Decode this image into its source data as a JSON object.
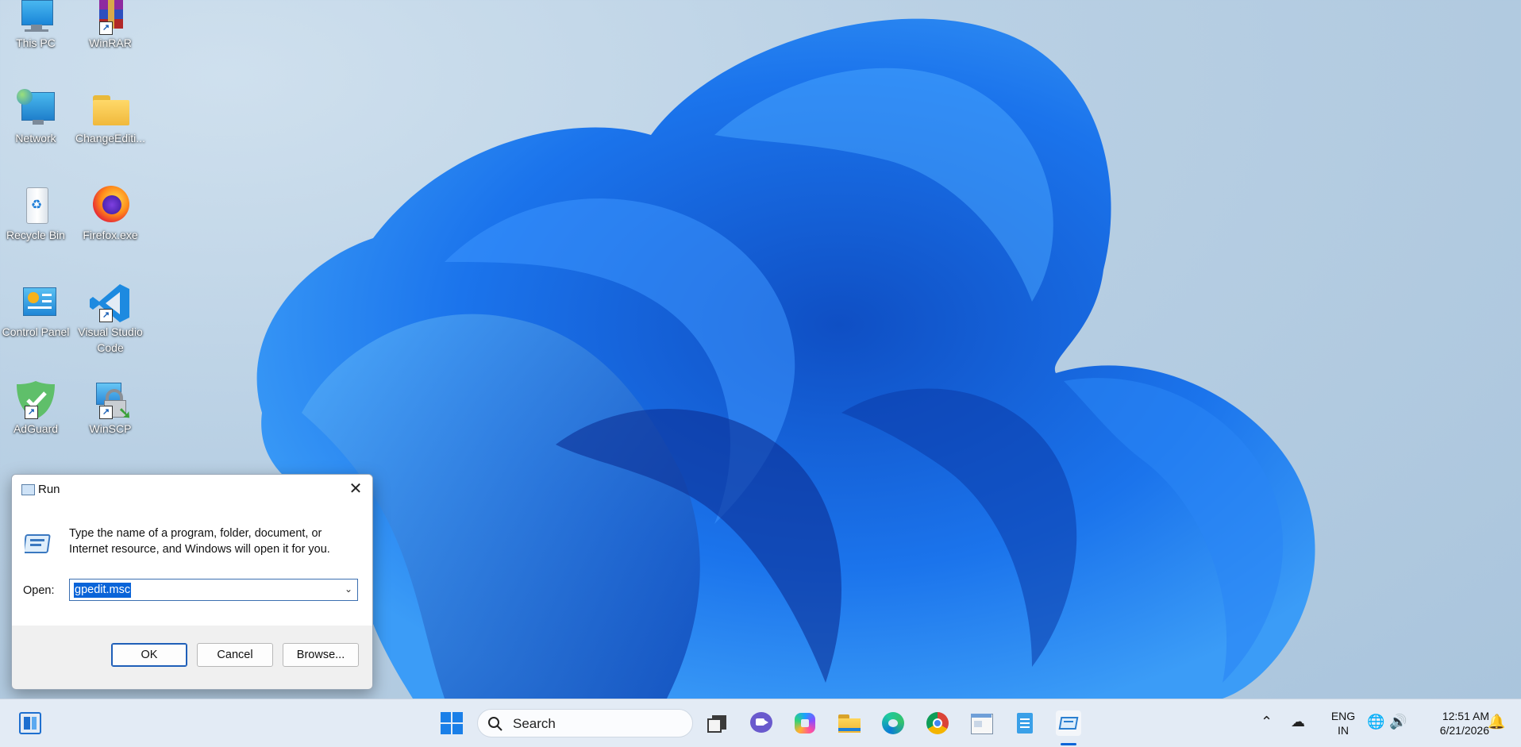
{
  "desktop": {
    "icons": [
      {
        "label": "This PC"
      },
      {
        "label": "WinRAR"
      },
      {
        "label": "Network"
      },
      {
        "label": "ChangeEditi..."
      },
      {
        "label": "Recycle Bin"
      },
      {
        "label": "Firefox.exe"
      },
      {
        "label": "Control Panel"
      },
      {
        "label": "Visual Studio Code"
      },
      {
        "label": "AdGuard"
      },
      {
        "label": "WinSCP"
      }
    ]
  },
  "run_dialog": {
    "title": "Run",
    "close_glyph": "✕",
    "description": "Type the name of a program, folder, document, or Internet resource, and Windows will open it for you.",
    "open_label": "Open:",
    "open_value": "gpedit.msc",
    "dropdown_glyph": "⌄",
    "ok_label": "OK",
    "cancel_label": "Cancel",
    "browse_label": "Browse..."
  },
  "taskbar": {
    "search_placeholder": "Search",
    "pinned": [
      "start-icon",
      "task-view-icon",
      "teams-chat-icon",
      "copilot-icon",
      "file-explorer-icon",
      "edge-icon",
      "chrome-icon",
      "app-window-icon",
      "notepad-icon",
      "run-app-icon"
    ],
    "active_app": "run-app-icon",
    "tray": {
      "lang_line1": "ENG",
      "lang_line2": "IN",
      "time": "12:51 AM",
      "date": "6/21/2026"
    }
  },
  "colors": {
    "accent": "#0a64d8",
    "taskbar_bg": "#e3ebf5",
    "wallpaper_bg": "#b9d0e4",
    "bloom": "#1a6fe0"
  }
}
